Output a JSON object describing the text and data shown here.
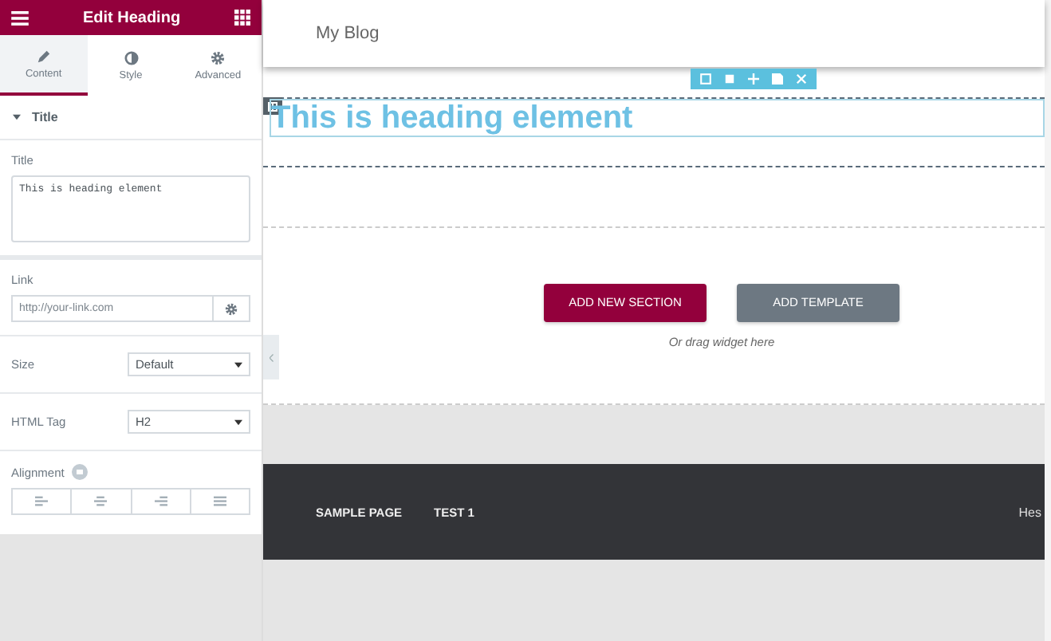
{
  "panel": {
    "title": "Edit Heading",
    "tabs": [
      {
        "label": "Content",
        "selected": true
      },
      {
        "label": "Style",
        "selected": false
      },
      {
        "label": "Advanced",
        "selected": false
      }
    ],
    "section": {
      "title": "Title",
      "expanded": true
    },
    "title_field": {
      "label": "Title",
      "value": "This is heading element"
    },
    "link_field": {
      "label": "Link",
      "placeholder": "http://your-link.com"
    },
    "size": {
      "label": "Size",
      "value": "Default"
    },
    "html_tag": {
      "label": "HTML Tag",
      "value": "H2"
    },
    "alignment": {
      "label": "Alignment",
      "options": [
        {
          "kind": "left",
          "selected": false
        },
        {
          "kind": "center",
          "selected": false
        },
        {
          "kind": "right",
          "selected": false
        },
        {
          "kind": "justify",
          "selected": false
        }
      ]
    }
  },
  "canvas": {
    "site_title": "My Blog",
    "heading": "This is heading element",
    "add_section_button": "ADD NEW SECTION",
    "add_template_button": "ADD TEMPLATE",
    "drag_hint": "Or drag widget here",
    "footer_menu": [
      "SAMPLE PAGE",
      "TEST 1"
    ],
    "footer_right": "Hes"
  }
}
